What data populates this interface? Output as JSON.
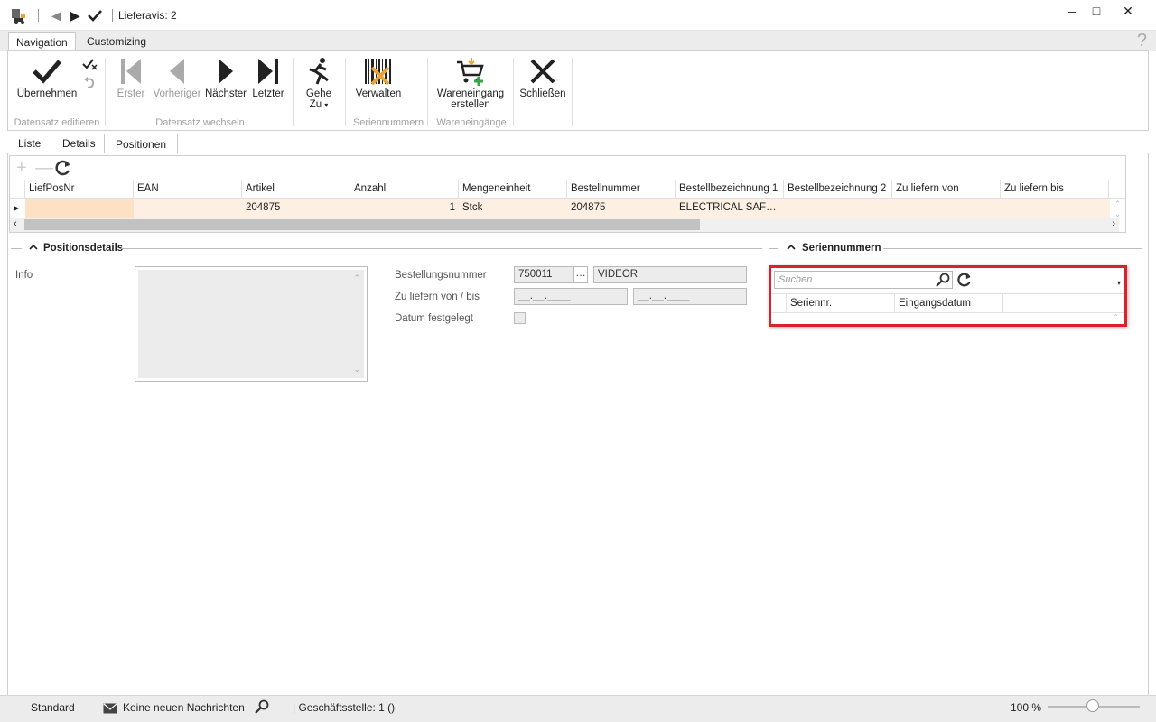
{
  "window": {
    "title": "Lieferavis: 2"
  },
  "ribbon_tabs": [
    "Navigation",
    "Customizing"
  ],
  "ribbon": {
    "uebernehmen": "Übernehmen",
    "erster": "Erster",
    "vorheriger": "Vorheriger",
    "naechster": "Nächster",
    "letzter": "Letzter",
    "gehe_line1": "Gehe",
    "gehe_line2": "Zu",
    "verwalten": "Verwalten",
    "wareneingang_line1": "Wareneingang",
    "wareneingang_line2": "erstellen",
    "schliessen": "Schließen",
    "groups": {
      "datensatz_editieren": "Datensatz editieren",
      "datensatz_wechseln": "Datensatz wechseln",
      "seriennummern": "Seriennummern",
      "wareneingaenge": "Wareneingänge"
    }
  },
  "subtabs": [
    "Liste",
    "Details",
    "Positionen"
  ],
  "grid": {
    "columns": [
      "LiefPosNr",
      "EAN",
      "Artikel",
      "Anzahl",
      "Mengeneinheit",
      "Bestellnummer",
      "Bestellbezeichnung 1",
      "Bestellbezeichnung 2",
      "Zu liefern von",
      "Zu liefern bis"
    ],
    "rows": [
      [
        "",
        "",
        "204875",
        "1",
        "Stck",
        "204875",
        "ELECTRICAL SAFETY...",
        "",
        "",
        ""
      ]
    ]
  },
  "positionsdetails": {
    "title": "Positionsdetails",
    "info_label": "Info",
    "bestellungsnummer_label": "Bestellungsnummer",
    "bestellungsnummer_value": "750011",
    "lieferant_value": "VIDEOR",
    "zu_liefern_label": "Zu liefern von / bis",
    "date_from": "__.__.____",
    "date_to": "__.__.____",
    "datum_label": "Datum festgelegt"
  },
  "seriennummern": {
    "title": "Seriennummern",
    "search_placeholder": "Suchen",
    "columns": [
      "Seriennr.",
      "Eingangsdatum"
    ]
  },
  "statusbar": {
    "profile": "Standard",
    "messages": "Keine neuen Nachrichten",
    "branch": "| Geschäftsstelle:  1 ()",
    "zoom": "100 %"
  },
  "colors": {
    "highlight": "#d9222a",
    "row_selected": "#fdf0e3",
    "cell_active": "#fde1c4"
  }
}
